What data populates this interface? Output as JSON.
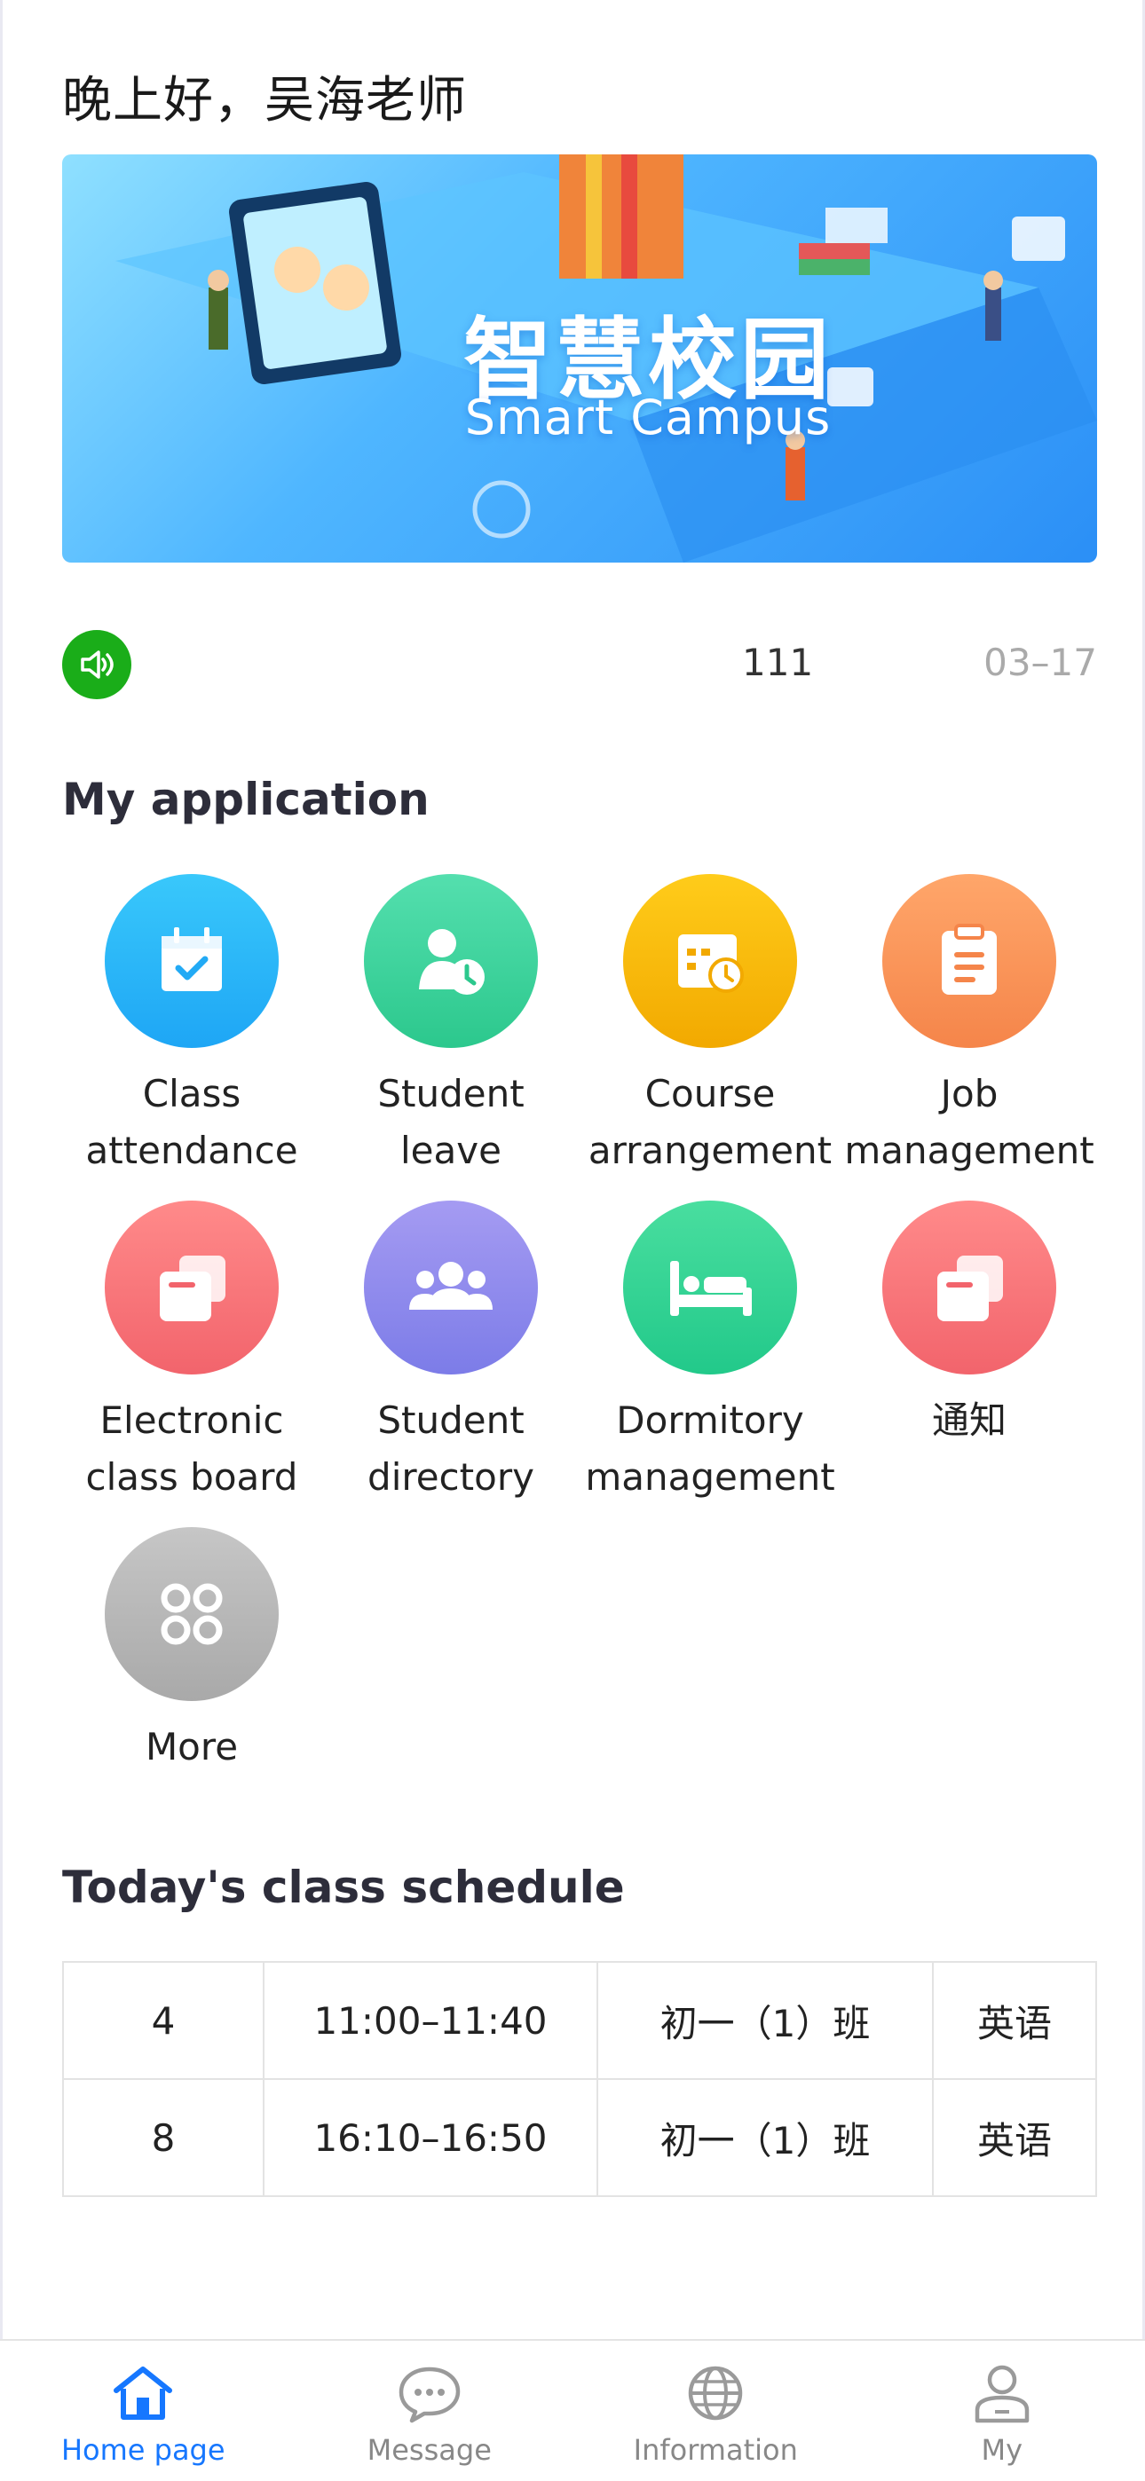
{
  "greeting": "晚上好，吴海老师",
  "banner": {
    "title": "智慧校园",
    "subtitle": "Smart Campus"
  },
  "notice": {
    "icon": "speaker-icon",
    "text": "111",
    "date": "03–17"
  },
  "applications": {
    "title": "My application",
    "items": [
      {
        "label_lines": [
          "Class",
          "attendance"
        ],
        "icon": "calendar-check-icon",
        "color": "#2bb7f7"
      },
      {
        "label_lines": [
          "Student leave",
          ""
        ],
        "icon": "person-clock-icon",
        "color": "#3fd6a0"
      },
      {
        "label_lines": [
          "Course",
          "arrangement"
        ],
        "icon": "schedule-clock-icon",
        "color": "#f7b500"
      },
      {
        "label_lines": [
          "Job",
          "management"
        ],
        "icon": "clipboard-icon",
        "color": "#f7925a"
      },
      {
        "label_lines": [
          "Electronic",
          "class board"
        ],
        "icon": "cards-icon",
        "color": "#f56a73"
      },
      {
        "label_lines": [
          "Student",
          "directory"
        ],
        "icon": "group-icon",
        "color": "#8a86ee"
      },
      {
        "label_lines": [
          "Dormitory",
          "management"
        ],
        "icon": "bed-icon",
        "color": "#2fd69a"
      },
      {
        "label_lines": [
          "通知",
          ""
        ],
        "icon": "cards-icon",
        "color": "#f56a73"
      },
      {
        "label_lines": [
          "More",
          ""
        ],
        "icon": "grid-icon",
        "color": "#adadad"
      }
    ]
  },
  "schedule": {
    "title": "Today's class schedule",
    "rows": [
      {
        "period": "4",
        "time": "11:00–11:40",
        "class": "初一（1）班",
        "subject": "英语"
      },
      {
        "period": "8",
        "time": "16:10–16:50",
        "class": "初一（1）班",
        "subject": "英语"
      }
    ]
  },
  "tabbar": {
    "items": [
      {
        "label": "Home page",
        "icon": "home-icon",
        "active": true
      },
      {
        "label": "Message",
        "icon": "message-icon",
        "active": false
      },
      {
        "label": "Information",
        "icon": "globe-icon",
        "active": false
      },
      {
        "label": "My",
        "icon": "user-icon",
        "active": false
      }
    ],
    "active_color": "#1677ff",
    "inactive_color": "#888888"
  }
}
